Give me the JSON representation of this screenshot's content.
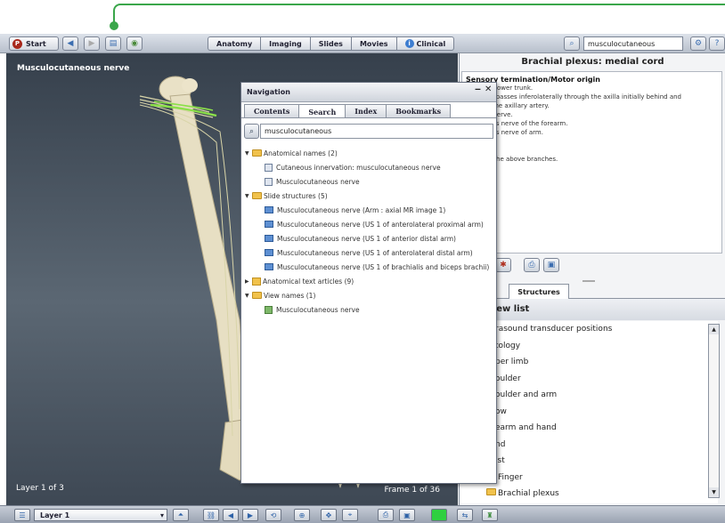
{
  "toolbar": {
    "start_label": "Start",
    "tabs": [
      "Anatomy",
      "Imaging",
      "Slides",
      "Movies",
      "Clinical"
    ],
    "search_value": "musculocutaneous"
  },
  "viewer": {
    "title": "Musculocutaneous nerve",
    "layer_text": "Layer 1 of 3",
    "frame_text": "Frame 1 of 36"
  },
  "article": {
    "title": "Brachial plexus: medial cord",
    "heading": "Sensory termination/Motor origin",
    "lines": [
      "exus: lower trunk.",
      "",
      "l cord passes inferolaterally through the axilla initially behind and",
      "al to the axillary artery.",
      "",
      "",
      "toral nerve.",
      "aneous nerve of the forearm.",
      "aneous nerve of arm.",
      "e.",
      "rve.",
      "",
      "",
      "d via the above branches."
    ]
  },
  "structures_tab": {
    "label": "Structures",
    "heading": "omy view list",
    "items": [
      "rasound transducer positions",
      "tology",
      "per limb",
      "oulder",
      "oulder and arm",
      "ow",
      "earm and hand",
      "nd",
      "ist",
      "Finger",
      "Brachial plexus"
    ]
  },
  "bottom_bar": {
    "layer_select": "Layer 1"
  },
  "navigation": {
    "title": "Navigation",
    "tabs": [
      "Contents",
      "Search",
      "Index",
      "Bookmarks"
    ],
    "search_value": "musculocutaneous",
    "tree": {
      "anatomical_names": "Anatomical names (2)",
      "anatomical_items": [
        "Cutaneous innervation: musculocutaneous nerve",
        "Musculocutaneous nerve"
      ],
      "slide_structures": "Slide structures (5)",
      "slide_items": [
        "Musculocutaneous nerve (Arm : axial MR image 1)",
        "Musculocutaneous nerve (US 1 of anterolateral proximal arm)",
        "Musculocutaneous nerve (US 1 of anterior distal arm)",
        "Musculocutaneous nerve (US 1 of anterolateral distal arm)",
        "Musculocutaneous nerve (US 1 of brachialis and biceps brachii)"
      ],
      "text_articles": "Anatomical text articles (9)",
      "view_names": "View names (1)",
      "view_items": [
        "Musculocutaneous nerve"
      ]
    }
  },
  "colors": {
    "callout": "#3aa64a",
    "nerve_highlight": "#8be04a",
    "start_button": "#a8281c"
  }
}
